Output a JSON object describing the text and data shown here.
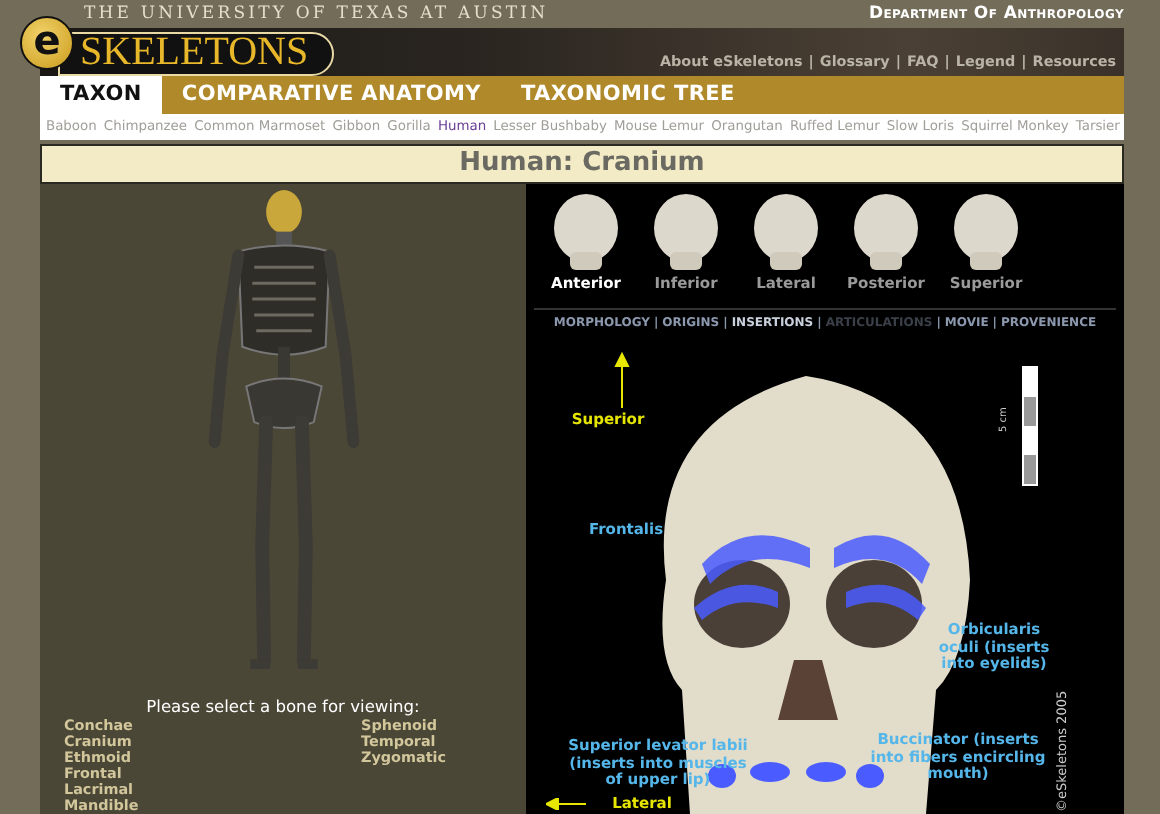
{
  "header": {
    "university": "THE UNIVERSITY OF TEXAS AT AUSTIN",
    "logo_mark": "e",
    "logo_text": "SKELETONS",
    "department": "Department Of Anthropology",
    "links": [
      "About eSkeletons",
      "Glossary",
      "FAQ",
      "Legend",
      "Resources"
    ],
    "separator": "|"
  },
  "tabs": [
    {
      "label": "TAXON",
      "selected": true
    },
    {
      "label": "COMPARATIVE ANATOMY",
      "selected": false
    },
    {
      "label": "TAXONOMIC TREE",
      "selected": false
    }
  ],
  "species": [
    {
      "label": "Baboon",
      "selected": false
    },
    {
      "label": "Chimpanzee",
      "selected": false
    },
    {
      "label": "Common Marmoset",
      "selected": false
    },
    {
      "label": "Gibbon",
      "selected": false
    },
    {
      "label": "Gorilla",
      "selected": false
    },
    {
      "label": "Human",
      "selected": true
    },
    {
      "label": "Lesser Bushbaby",
      "selected": false
    },
    {
      "label": "Mouse Lemur",
      "selected": false
    },
    {
      "label": "Orangutan",
      "selected": false
    },
    {
      "label": "Ruffed Lemur",
      "selected": false
    },
    {
      "label": "Slow Loris",
      "selected": false
    },
    {
      "label": "Squirrel Monkey",
      "selected": false
    },
    {
      "label": "Tarsier",
      "selected": false
    }
  ],
  "page_title": "Human: Cranium",
  "bone_panel": {
    "prompt": "Please select a bone for viewing:",
    "columns": [
      [
        "Conchae",
        "Cranium",
        "Ethmoid",
        "Frontal",
        "Lacrimal",
        "Mandible"
      ],
      [
        "Sphenoid",
        "Temporal",
        "Zygomatic"
      ]
    ]
  },
  "views": [
    {
      "label": "Anterior",
      "selected": true
    },
    {
      "label": "Inferior",
      "selected": false
    },
    {
      "label": "Lateral",
      "selected": false
    },
    {
      "label": "Posterior",
      "selected": false
    },
    {
      "label": "Superior",
      "selected": false
    }
  ],
  "subnav_separator": "|",
  "subnav": [
    {
      "label": "MORPHOLOGY",
      "selected": false,
      "disabled": false
    },
    {
      "label": "ORIGINS",
      "selected": false,
      "disabled": false
    },
    {
      "label": "INSERTIONS",
      "selected": true,
      "disabled": false
    },
    {
      "label": "ARTICULATIONS",
      "selected": false,
      "disabled": true
    },
    {
      "label": "MOVIE",
      "selected": false,
      "disabled": false
    },
    {
      "label": "PROVENIENCE",
      "selected": false,
      "disabled": false
    }
  ],
  "figure": {
    "scale_label": "5 cm",
    "copyright": "©eSkeletons 2005",
    "annotations": [
      {
        "kind": "direction",
        "text": "Superior"
      },
      {
        "kind": "muscle",
        "text": "Frontalis"
      },
      {
        "kind": "muscle",
        "text": "Orbicularis oculi (inserts into eyelids)"
      },
      {
        "kind": "muscle",
        "text": "Superior levator labii (inserts into muscles of upper lip)"
      },
      {
        "kind": "muscle",
        "text": "Buccinator (inserts into fibers encircling mouth)"
      },
      {
        "kind": "direction",
        "text": "Lateral"
      }
    ]
  }
}
